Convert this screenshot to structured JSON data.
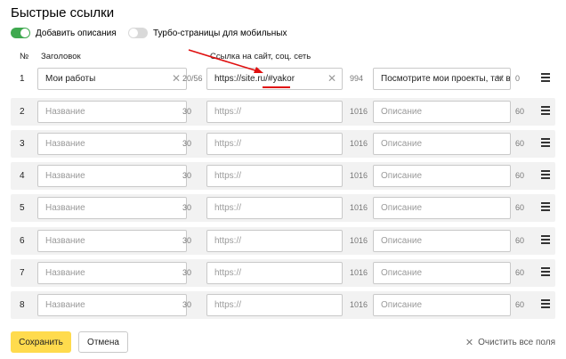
{
  "title": "Быстрые ссылки",
  "toggles": {
    "descriptions_label": "Добавить описания",
    "turbo_label": "Турбо-страницы для мобильных"
  },
  "headers": {
    "num": "№",
    "title": "Заголовок",
    "link": "Ссылка на сайт, соц. сеть"
  },
  "rows": [
    {
      "num": "1",
      "title": "Мои работы",
      "title_count": "20/56",
      "link": "https://site.ru/#yakor",
      "link_count": "994",
      "desc": "Посмотрите мои проекты, так вы",
      "desc_count": "0"
    },
    {
      "num": "2",
      "title": "",
      "title_count": "30",
      "link": "",
      "link_count": "1016",
      "desc": "",
      "desc_count": "60"
    },
    {
      "num": "3",
      "title": "",
      "title_count": "30",
      "link": "",
      "link_count": "1016",
      "desc": "",
      "desc_count": "60"
    },
    {
      "num": "4",
      "title": "",
      "title_count": "30",
      "link": "",
      "link_count": "1016",
      "desc": "",
      "desc_count": "60"
    },
    {
      "num": "5",
      "title": "",
      "title_count": "30",
      "link": "",
      "link_count": "1016",
      "desc": "",
      "desc_count": "60"
    },
    {
      "num": "6",
      "title": "",
      "title_count": "30",
      "link": "",
      "link_count": "1016",
      "desc": "",
      "desc_count": "60"
    },
    {
      "num": "7",
      "title": "",
      "title_count": "30",
      "link": "",
      "link_count": "1016",
      "desc": "",
      "desc_count": "60"
    },
    {
      "num": "8",
      "title": "",
      "title_count": "30",
      "link": "",
      "link_count": "1016",
      "desc": "",
      "desc_count": "60"
    }
  ],
  "placeholders": {
    "title": "Название",
    "link": "https://",
    "desc": "Описание"
  },
  "icons": {
    "clear": "close-icon",
    "drag": "drag-handle-icon",
    "annotation": "red-arrow"
  },
  "colors": {
    "accent_green": "#3fa94f",
    "save_yellow": "#ffdb4d",
    "annotation_red": "#e01010"
  },
  "buttons": {
    "save": "Сохранить",
    "cancel": "Отмена",
    "clear_all": "Очистить все поля"
  }
}
